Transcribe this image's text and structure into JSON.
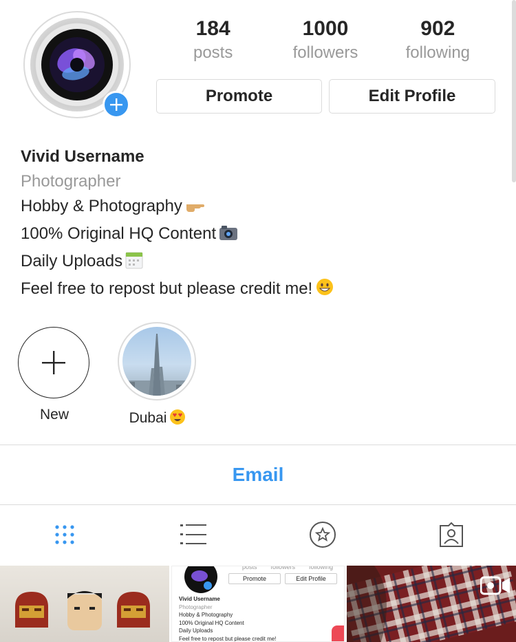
{
  "profile": {
    "stats": [
      {
        "value": "184",
        "label": "posts"
      },
      {
        "value": "1000",
        "label": "followers"
      },
      {
        "value": "902",
        "label": "following"
      }
    ],
    "promote_label": "Promote",
    "edit_label": "Edit Profile"
  },
  "bio": {
    "name": "Vivid Username",
    "category": "Photographer",
    "lines": [
      "Hobby & Photography",
      "100% Original HQ Content",
      "Daily Uploads",
      "Feel free to repost but please credit me!"
    ]
  },
  "highlights": [
    {
      "label": "New",
      "icon": "plus-icon"
    },
    {
      "label": "Dubai",
      "icon": "heart-eyes-emoji"
    }
  ],
  "contact": {
    "email_label": "Email"
  },
  "tabs": [
    "grid-icon",
    "list-icon",
    "saved-star-icon",
    "tagged-person-icon"
  ],
  "thumbnail": {
    "stats": [
      "posts",
      "followers",
      "following"
    ],
    "promote_label": "Promote",
    "edit_label": "Edit Profile",
    "name": "Vivid Username",
    "category": "Photographer",
    "lines": [
      "Hobby & Photography",
      "100% Original HQ Content",
      "Daily Uploads",
      "Feel free to repost but please credit me!"
    ]
  },
  "colors": {
    "accent": "#3897f0",
    "text": "#262626",
    "muted": "#999999",
    "border": "#dbdbdb"
  }
}
